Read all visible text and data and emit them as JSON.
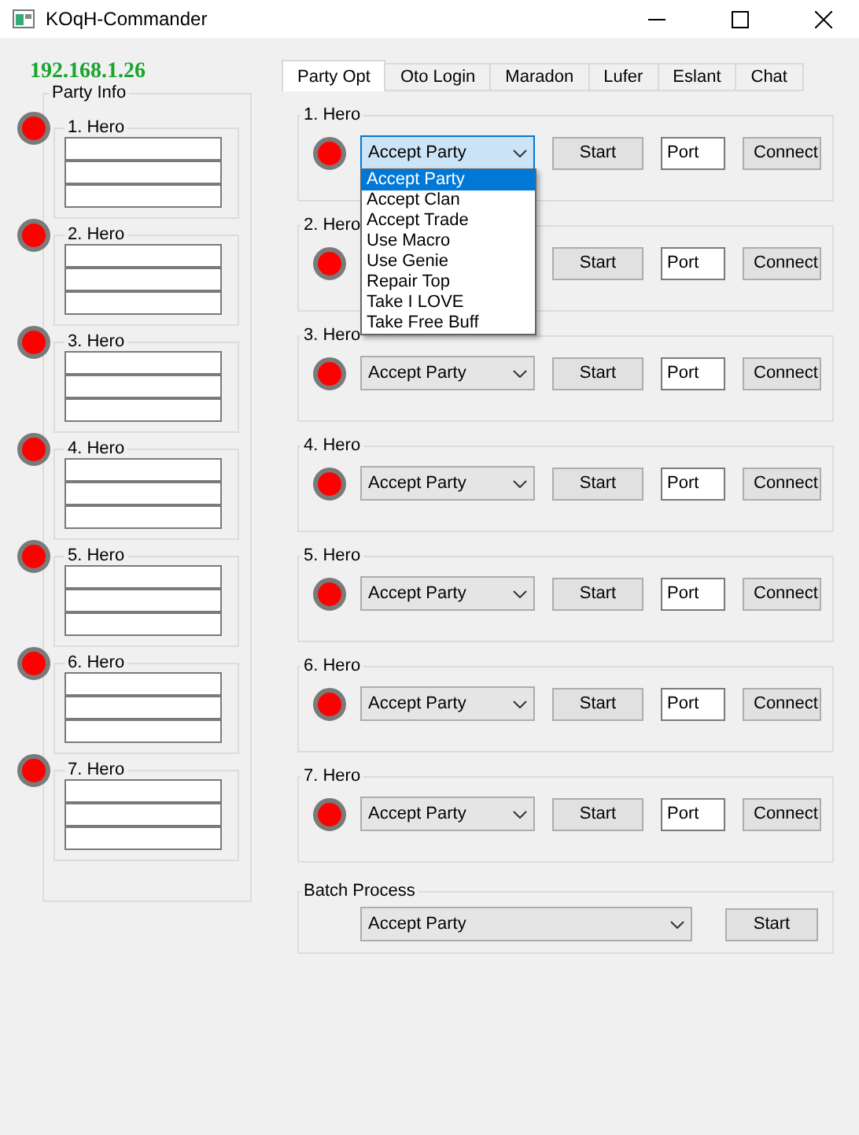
{
  "window": {
    "title": "KOqH-Commander"
  },
  "ip": "192.168.1.26",
  "party_info": {
    "title": "Party Info",
    "heroes": [
      {
        "label": "1. Hero",
        "connected": false
      },
      {
        "label": "2. Hero",
        "connected": false
      },
      {
        "label": "3. Hero",
        "connected": false
      },
      {
        "label": "4. Hero",
        "connected": false
      },
      {
        "label": "5. Hero",
        "connected": false
      },
      {
        "label": "6. Hero",
        "connected": false
      },
      {
        "label": "7. Hero",
        "connected": false
      }
    ]
  },
  "tabs": [
    {
      "label": "Party Opt",
      "selected": true
    },
    {
      "label": "Oto Login",
      "selected": false
    },
    {
      "label": "Maradon",
      "selected": false
    },
    {
      "label": "Lufer",
      "selected": false
    },
    {
      "label": "Eslant",
      "selected": false
    },
    {
      "label": "Chat",
      "selected": false
    }
  ],
  "heroes": [
    {
      "label": "1. Hero",
      "connected": false,
      "action": "Accept Party",
      "expanded": true,
      "start": "Start",
      "port": "Port",
      "connect": "Connect"
    },
    {
      "label": "2. Hero",
      "connected": false,
      "expanded": false,
      "start": "Start",
      "port": "Port",
      "connect": "Connect"
    },
    {
      "label": "3. Hero",
      "connected": false,
      "action": "Accept Party",
      "expanded": false,
      "start": "Start",
      "port": "Port",
      "connect": "Connect"
    },
    {
      "label": "4. Hero",
      "connected": false,
      "action": "Accept Party",
      "expanded": false,
      "start": "Start",
      "port": "Port",
      "connect": "Connect"
    },
    {
      "label": "5. Hero",
      "connected": false,
      "action": "Accept Party",
      "expanded": false,
      "start": "Start",
      "port": "Port",
      "connect": "Connect"
    },
    {
      "label": "6. Hero",
      "connected": false,
      "action": "Accept Party",
      "expanded": false,
      "start": "Start",
      "port": "Port",
      "connect": "Connect"
    },
    {
      "label": "7. Hero",
      "connected": false,
      "action": "Accept Party",
      "expanded": false,
      "start": "Start",
      "port": "Port",
      "connect": "Connect"
    }
  ],
  "dropdown_options": [
    {
      "label": "Accept Party",
      "selected": true
    },
    {
      "label": "Accept Clan",
      "selected": false
    },
    {
      "label": "Accept Trade",
      "selected": false
    },
    {
      "label": "Use Macro",
      "selected": false
    },
    {
      "label": "Use Genie",
      "selected": false
    },
    {
      "label": "Repair Top",
      "selected": false
    },
    {
      "label": "Take I LOVE",
      "selected": false
    },
    {
      "label": "Take Free Buff",
      "selected": false
    }
  ],
  "batch": {
    "title": "Batch Process",
    "action": "Accept Party",
    "start": "Start"
  }
}
